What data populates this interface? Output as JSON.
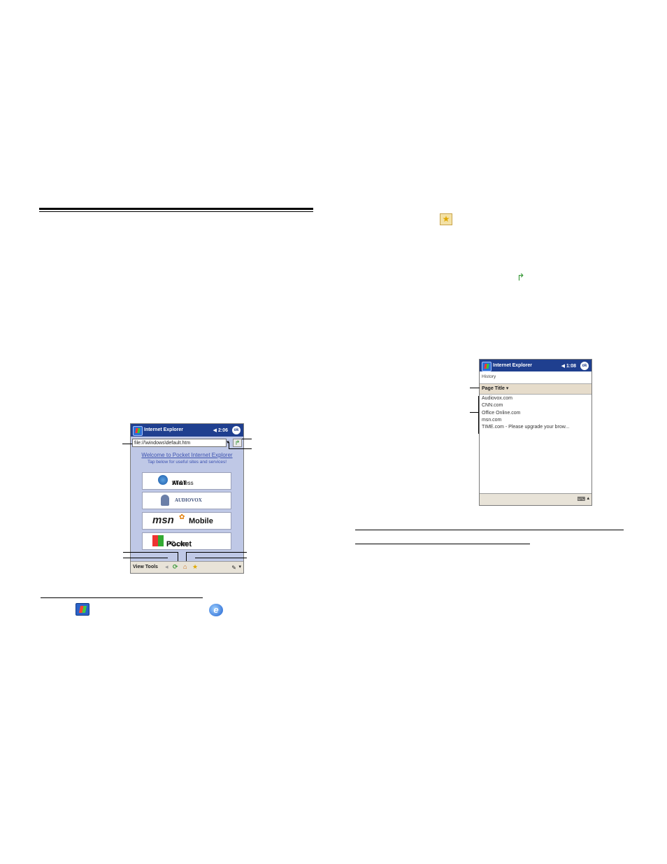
{
  "screen1": {
    "title": "Internet Explorer",
    "time": "2:06",
    "ok_label": "ok",
    "address_value": "file://\\windows\\default.htm",
    "welcome_text": "Welcome to Pocket Internet Explorer",
    "tap_text": "Tap below for useful sites and services!",
    "links": [
      {
        "label_bold": "AT&T",
        "label_rest": "Wireless"
      },
      {
        "label_bold": "AUDIOVOX",
        "label_rest": ""
      },
      {
        "label_bold": "msn",
        "label_rest": "Mobile"
      },
      {
        "label_bold": "Pocket",
        "label_rest": "PC.com"
      }
    ],
    "menus": [
      "View",
      "Tools"
    ]
  },
  "screen2": {
    "title": "Internet Explorer",
    "time": "1:08",
    "ok_label": "ok",
    "section_label": "History",
    "column_header": "Page Title",
    "items": [
      "Audiovox.com",
      "CNN.com",
      "Office Online.com",
      "msn.com",
      "TIME.com - Please upgrade your brow..."
    ]
  },
  "icons": {
    "favorites": "star-icon",
    "forward": "forward-arrow-icon",
    "start": "windows-start-icon",
    "ie": "internet-explorer-icon"
  },
  "colors": {
    "titlebar": "#1f3f8f",
    "screen_bg": "#bfc8e6",
    "toolbar": "#e8e3d8",
    "link": "#3c52b0"
  }
}
